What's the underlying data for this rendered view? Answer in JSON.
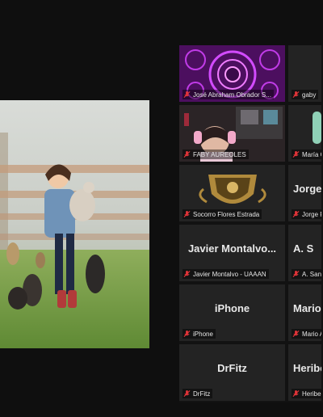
{
  "shared_screen": {
    "description": "shared-photo"
  },
  "participants": [
    {
      "id": "p1",
      "label": "José Abraham Obrador S...",
      "big_name": "",
      "muted": true
    },
    {
      "id": "p2",
      "label": "gaby",
      "big_name": "",
      "muted": true
    },
    {
      "id": "p3",
      "label": "FABY AUREOLES",
      "big_name": "",
      "muted": true
    },
    {
      "id": "p4",
      "label": "María G",
      "big_name": "",
      "muted": true
    },
    {
      "id": "p5",
      "label": "Socorro Flores Estrada",
      "big_name": "",
      "muted": true
    },
    {
      "id": "p6",
      "label": "Jorge F",
      "big_name": "Jorge",
      "muted": true
    },
    {
      "id": "p7",
      "label": "Javier Montalvo - UAAAN",
      "big_name": "Javier  Montalvo...",
      "muted": true
    },
    {
      "id": "p8",
      "label": "A. Sand",
      "big_name": "A. S",
      "muted": true
    },
    {
      "id": "p9",
      "label": "iPhone",
      "big_name": "iPhone",
      "muted": true
    },
    {
      "id": "p10",
      "label": "Mario A",
      "big_name": "Mario",
      "muted": true
    },
    {
      "id": "p11",
      "label": "DrFitz",
      "big_name": "DrFitz",
      "muted": true
    },
    {
      "id": "p12",
      "label": "Heribe",
      "big_name": "Heribe",
      "muted": true
    }
  ],
  "colors": {
    "muted_icon": "#e8353a",
    "tile_bg": "#232323",
    "app_bg": "#0f0f0f"
  }
}
